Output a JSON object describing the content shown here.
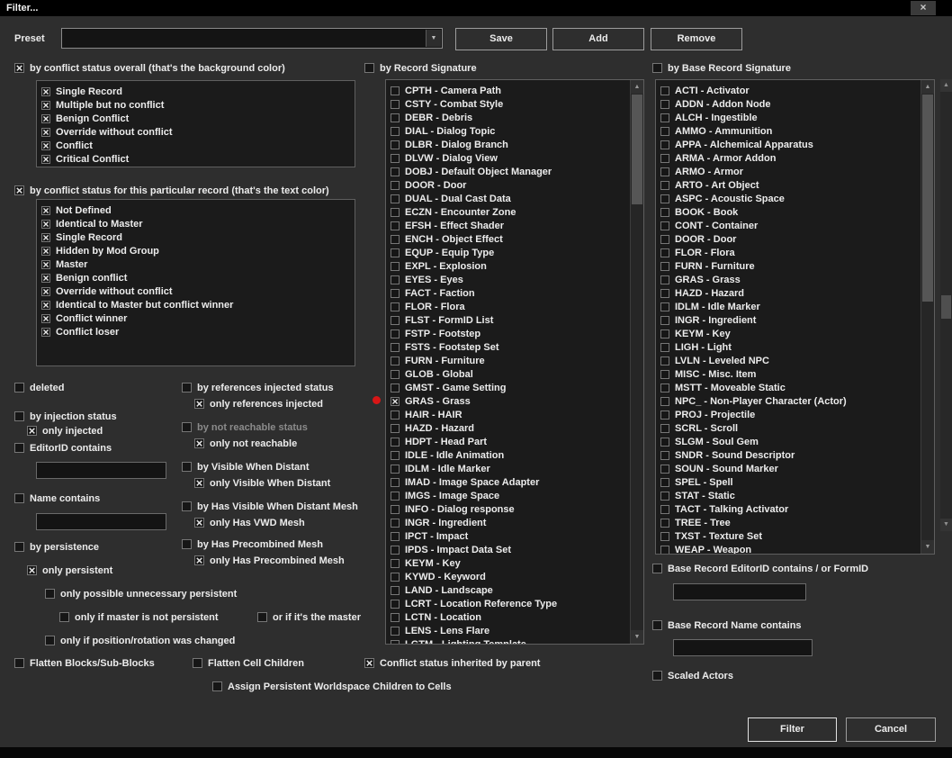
{
  "window": {
    "title": "Filter..."
  },
  "icons": {
    "close": "×",
    "dropdown": "▼",
    "up": "▲",
    "down": "▼"
  },
  "colors": {
    "background": "#2e2e2e",
    "listbox": "#1b1b1b",
    "marker": "#d81616",
    "titlebar": "#000000"
  },
  "preset": {
    "label": "Preset",
    "value": "",
    "save_label": "Save",
    "add_label": "Add",
    "remove_label": "Remove"
  },
  "filters": {
    "overall": {
      "label": "by conflict status overall (that's the background color)",
      "checked": true,
      "items": [
        {
          "label": "Single Record",
          "checked": true
        },
        {
          "label": "Multiple but no conflict",
          "checked": true
        },
        {
          "label": "Benign Conflict",
          "checked": true
        },
        {
          "label": "Override without conflict",
          "checked": true
        },
        {
          "label": "Conflict",
          "checked": true
        },
        {
          "label": "Critical Conflict",
          "checked": true
        }
      ]
    },
    "particular": {
      "label": "by conflict status for this particular record  (that's the text color)",
      "checked": true,
      "items": [
        {
          "label": "Not Defined",
          "checked": true
        },
        {
          "label": "Identical to Master",
          "checked": true
        },
        {
          "label": "Single Record",
          "checked": true
        },
        {
          "label": "Hidden by Mod Group",
          "checked": true
        },
        {
          "label": "Master",
          "checked": true
        },
        {
          "label": "Benign conflict",
          "checked": true
        },
        {
          "label": "Override without conflict",
          "checked": true
        },
        {
          "label": "Identical to Master but conflict winner",
          "checked": true
        },
        {
          "label": "Conflict winner",
          "checked": true
        },
        {
          "label": "Conflict loser",
          "checked": true
        }
      ]
    },
    "record_signature": {
      "label": "by Record Signature",
      "checked": false,
      "marker": {
        "item": "GRAS - Grass",
        "color": "#d81616"
      },
      "items": [
        {
          "label": "CPTH - Camera Path",
          "checked": false
        },
        {
          "label": "CSTY - Combat Style",
          "checked": false
        },
        {
          "label": "DEBR - Debris",
          "checked": false
        },
        {
          "label": "DIAL - Dialog Topic",
          "checked": false
        },
        {
          "label": "DLBR - Dialog Branch",
          "checked": false
        },
        {
          "label": "DLVW - Dialog View",
          "checked": false
        },
        {
          "label": "DOBJ - Default Object Manager",
          "checked": false
        },
        {
          "label": "DOOR - Door",
          "checked": false
        },
        {
          "label": "DUAL - Dual Cast Data",
          "checked": false
        },
        {
          "label": "ECZN - Encounter Zone",
          "checked": false
        },
        {
          "label": "EFSH - Effect Shader",
          "checked": false
        },
        {
          "label": "ENCH - Object Effect",
          "checked": false
        },
        {
          "label": "EQUP - Equip Type",
          "checked": false
        },
        {
          "label": "EXPL - Explosion",
          "checked": false
        },
        {
          "label": "EYES - Eyes",
          "checked": false
        },
        {
          "label": "FACT - Faction",
          "checked": false
        },
        {
          "label": "FLOR - Flora",
          "checked": false
        },
        {
          "label": "FLST - FormID List",
          "checked": false
        },
        {
          "label": "FSTP - Footstep",
          "checked": false
        },
        {
          "label": "FSTS - Footstep Set",
          "checked": false
        },
        {
          "label": "FURN - Furniture",
          "checked": false
        },
        {
          "label": "GLOB - Global",
          "checked": false
        },
        {
          "label": "GMST - Game Setting",
          "checked": false
        },
        {
          "label": "GRAS - Grass",
          "checked": true,
          "marked": true
        },
        {
          "label": "HAIR - HAIR",
          "checked": false
        },
        {
          "label": "HAZD - Hazard",
          "checked": false
        },
        {
          "label": "HDPT - Head Part",
          "checked": false
        },
        {
          "label": "IDLE - Idle Animation",
          "checked": false
        },
        {
          "label": "IDLM - Idle Marker",
          "checked": false
        },
        {
          "label": "IMAD - Image Space Adapter",
          "checked": false
        },
        {
          "label": "IMGS - Image Space",
          "checked": false
        },
        {
          "label": "INFO - Dialog response",
          "checked": false
        },
        {
          "label": "INGR - Ingredient",
          "checked": false
        },
        {
          "label": "IPCT - Impact",
          "checked": false
        },
        {
          "label": "IPDS - Impact Data Set",
          "checked": false
        },
        {
          "label": "KEYM - Key",
          "checked": false
        },
        {
          "label": "KYWD - Keyword",
          "checked": false
        },
        {
          "label": "LAND - Landscape",
          "checked": false
        },
        {
          "label": "LCRT - Location Reference Type",
          "checked": false
        },
        {
          "label": "LCTN - Location",
          "checked": false
        },
        {
          "label": "LENS - Lens Flare",
          "checked": false
        },
        {
          "label": "LGTM - Lighting Template",
          "checked": false
        }
      ]
    },
    "base_record_signature": {
      "label": "by Base Record Signature",
      "checked": false,
      "items": [
        {
          "label": "ACTI - Activator",
          "checked": false
        },
        {
          "label": "ADDN - Addon Node",
          "checked": false
        },
        {
          "label": "ALCH - Ingestible",
          "checked": false
        },
        {
          "label": "AMMO - Ammunition",
          "checked": false
        },
        {
          "label": "APPA - Alchemical Apparatus",
          "checked": false
        },
        {
          "label": "ARMA - Armor Addon",
          "checked": false
        },
        {
          "label": "ARMO - Armor",
          "checked": false
        },
        {
          "label": "ARTO - Art Object",
          "checked": false
        },
        {
          "label": "ASPC - Acoustic Space",
          "checked": false
        },
        {
          "label": "BOOK - Book",
          "checked": false
        },
        {
          "label": "CONT - Container",
          "checked": false
        },
        {
          "label": "DOOR - Door",
          "checked": false
        },
        {
          "label": "FLOR - Flora",
          "checked": false
        },
        {
          "label": "FURN - Furniture",
          "checked": false
        },
        {
          "label": "GRAS - Grass",
          "checked": false
        },
        {
          "label": "HAZD - Hazard",
          "checked": false
        },
        {
          "label": "IDLM - Idle Marker",
          "checked": false
        },
        {
          "label": "INGR - Ingredient",
          "checked": false
        },
        {
          "label": "KEYM - Key",
          "checked": false
        },
        {
          "label": "LIGH - Light",
          "checked": false
        },
        {
          "label": "LVLN - Leveled NPC",
          "checked": false
        },
        {
          "label": "MISC - Misc. Item",
          "checked": false
        },
        {
          "label": "MSTT - Moveable Static",
          "checked": false
        },
        {
          "label": "NPC_ - Non-Player Character (Actor)",
          "checked": false
        },
        {
          "label": "PROJ - Projectile",
          "checked": false
        },
        {
          "label": "SCRL - Scroll",
          "checked": false
        },
        {
          "label": "SLGM - Soul Gem",
          "checked": false
        },
        {
          "label": "SNDR - Sound Descriptor",
          "checked": false
        },
        {
          "label": "SOUN - Sound Marker",
          "checked": false
        },
        {
          "label": "SPEL - Spell",
          "checked": false
        },
        {
          "label": "STAT - Static",
          "checked": false
        },
        {
          "label": "TACT - Talking Activator",
          "checked": false
        },
        {
          "label": "TREE - Tree",
          "checked": false
        },
        {
          "label": "TXST - Texture Set",
          "checked": false
        },
        {
          "label": "WEAP - Weapon",
          "checked": false
        }
      ]
    }
  },
  "options": {
    "deleted": {
      "label": "deleted",
      "checked": false
    },
    "by_injection": {
      "label": "by injection status",
      "checked": false
    },
    "only_injected": {
      "label": "only injected",
      "checked": true
    },
    "editorid_contains": {
      "label": "EditorID contains",
      "checked": false,
      "value": ""
    },
    "name_contains": {
      "label": "Name contains",
      "checked": false,
      "value": ""
    },
    "by_persistence": {
      "label": "by persistence",
      "checked": false
    },
    "only_persistent": {
      "label": "only persistent",
      "checked": true
    },
    "only_possible_unnecessary": {
      "label": "only possible unnecessary persistent",
      "checked": false
    },
    "only_if_master_not_persistent": {
      "label": "only if master is not persistent",
      "checked": false
    },
    "or_if_its_the_master": {
      "label": "or if it's the master",
      "checked": false
    },
    "only_if_position_changed": {
      "label": "only if position/rotation was changed",
      "checked": false
    },
    "by_references_injected": {
      "label": "by references injected status",
      "checked": false
    },
    "only_references_injected": {
      "label": "only references injected",
      "checked": true
    },
    "by_not_reachable": {
      "label": "by not reachable status",
      "checked": false,
      "disabled": true
    },
    "only_not_reachable": {
      "label": "only not reachable",
      "checked": true
    },
    "by_visible_when_distant": {
      "label": "by Visible When Distant",
      "checked": false
    },
    "only_visible_when_distant": {
      "label": "only Visible When Distant",
      "checked": true
    },
    "by_has_vwd_mesh": {
      "label": "by Has Visible When Distant Mesh",
      "checked": false
    },
    "only_has_vwd_mesh": {
      "label": "only Has VWD Mesh",
      "checked": true
    },
    "by_has_precombined_mesh": {
      "label": "by Has Precombined Mesh",
      "checked": false
    },
    "only_has_precombined_mesh": {
      "label": "only Has Precombined Mesh",
      "checked": true
    },
    "flatten_blocks": {
      "label": "Flatten Blocks/Sub-Blocks",
      "checked": false
    },
    "flatten_cell_children": {
      "label": "Flatten Cell Children",
      "checked": false
    },
    "conflict_inherited": {
      "label": "Conflict status inherited by parent",
      "checked": true
    },
    "assign_persistent_worldspace": {
      "label": "Assign Persistent Worldspace Children to Cells",
      "checked": false
    },
    "base_editorid_contains": {
      "label": "Base Record EditorID contains / or FormID",
      "checked": false,
      "value": ""
    },
    "base_name_contains": {
      "label": "Base Record Name contains",
      "checked": false,
      "value": ""
    },
    "scaled_actors": {
      "label": "Scaled Actors",
      "checked": false
    }
  },
  "footer": {
    "filter_label": "Filter",
    "cancel_label": "Cancel"
  }
}
